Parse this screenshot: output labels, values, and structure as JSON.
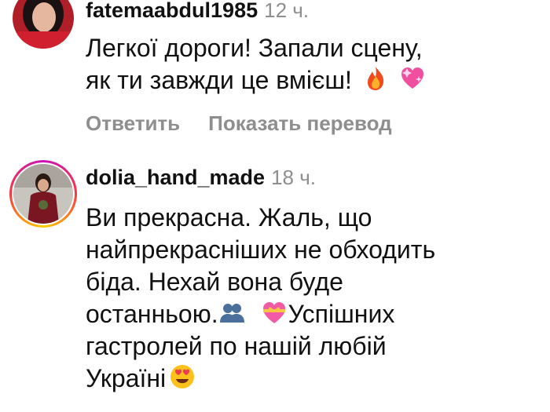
{
  "comments": [
    {
      "username": "fatemaabdul1985",
      "time": "12 ч.",
      "lines": [
        "Легкої дороги! Запали сцену,",
        "як ти завжди це вмієш!"
      ],
      "emojis": [
        "fire-emoji",
        "sparkling-heart-emoji"
      ],
      "reply_label": "Ответить",
      "translate_label": "Показать перевод"
    },
    {
      "username": "dolia_hand_made",
      "time": "18 ч.",
      "lines": [
        "Ви прекрасна. Жаль, що",
        "найпрекрасніших не обходить",
        "біда. Нехай вона буде",
        "останньою.",
        "Успішних",
        "гастролей по нашій любій",
        "Україні"
      ],
      "emojis": [
        "two-people-silhouette-emoji",
        "heart-with-ribbon-emoji",
        "heart-eyes-emoji"
      ]
    }
  ]
}
